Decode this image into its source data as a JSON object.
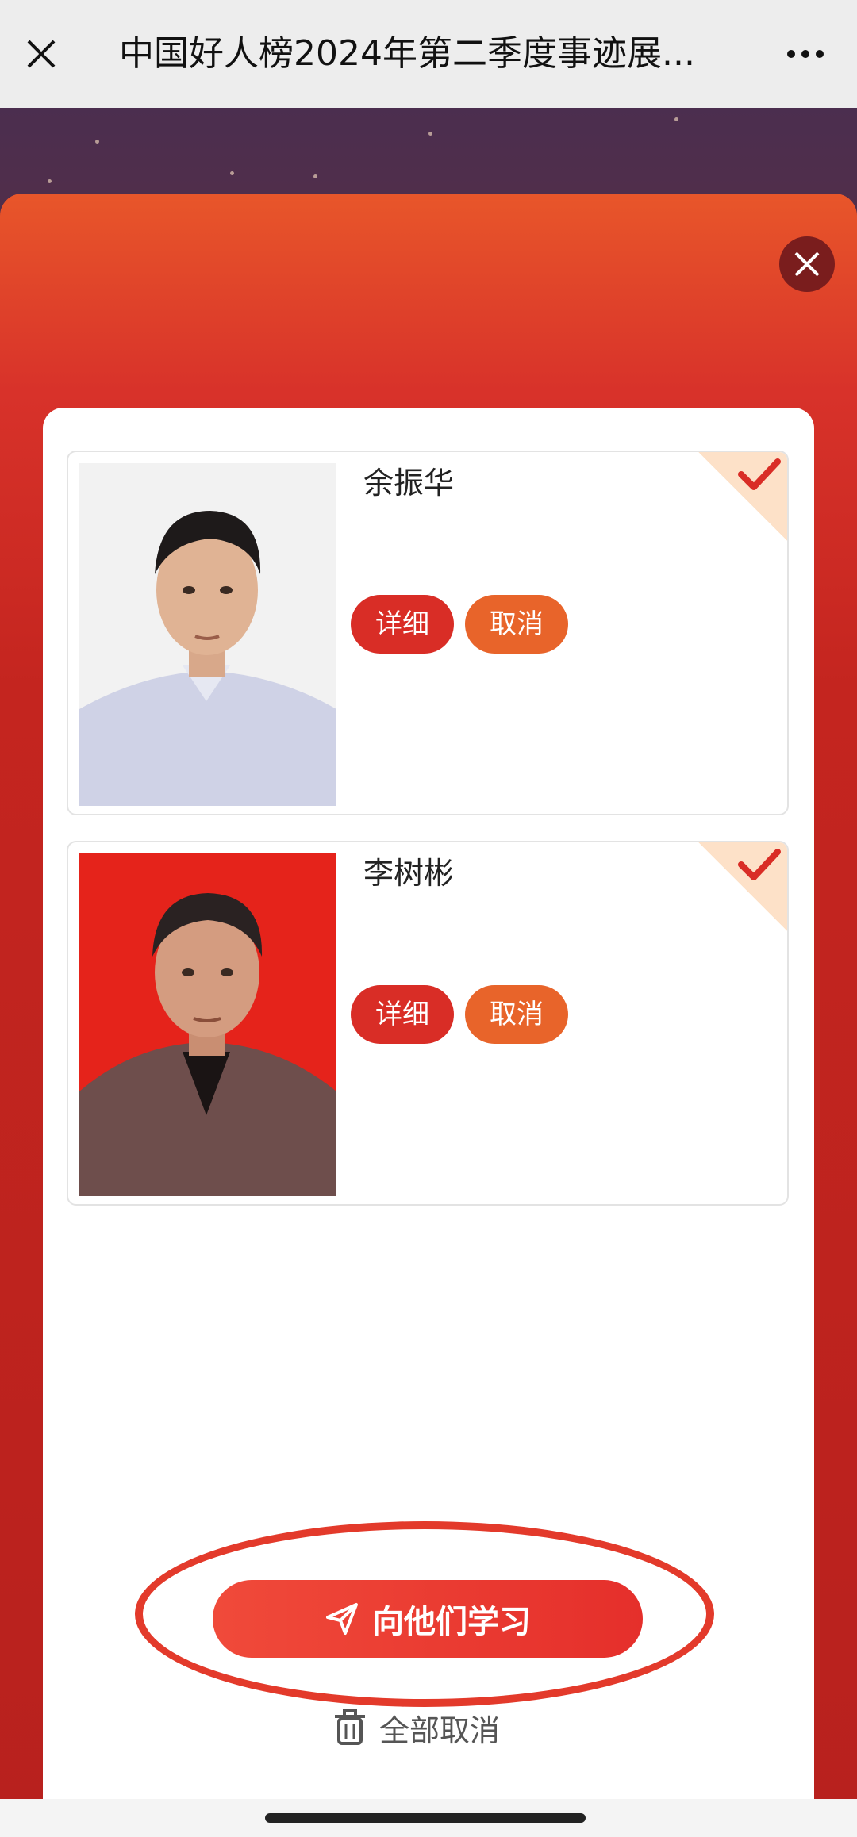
{
  "navbar": {
    "title": "中国好人榜2024年第二季度事迹展..."
  },
  "people": [
    {
      "name": "余振华",
      "detail_label": "详细",
      "cancel_label": "取消",
      "photo_background": "#f2f2f2",
      "selected": true
    },
    {
      "name": "李树彬",
      "detail_label": "详细",
      "cancel_label": "取消",
      "photo_background": "#e5231b",
      "selected": true
    }
  ],
  "actions": {
    "learn_label": "向他们学习",
    "cancel_all_label": "全部取消"
  },
  "colors": {
    "accent_red": "#d92d26",
    "accent_orange": "#e8642a",
    "highlight_ring": "#e33a2b"
  },
  "icons": {
    "nav_close": "close-icon",
    "nav_more": "more-icon",
    "panel_close": "close-icon",
    "learn": "send-icon",
    "cancel_all": "trash-icon",
    "selected": "checkmark-icon"
  }
}
